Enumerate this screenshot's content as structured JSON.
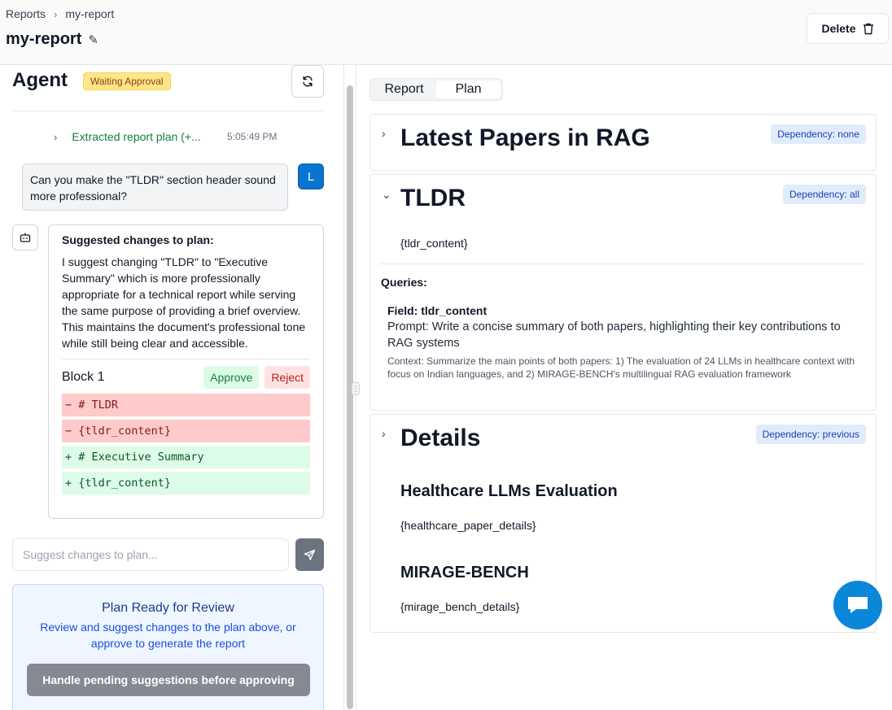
{
  "breadcrumb": {
    "root": "Reports",
    "separator": "›",
    "current": "my-report"
  },
  "header": {
    "title": "my-report",
    "delete_label": "Delete"
  },
  "agent": {
    "title": "Agent",
    "status_badge": "Waiting Approval",
    "extracted_text": "Extracted report plan (+...",
    "extracted_time": "5:05:49 PM",
    "user_message": "Can you make the \"TLDR\" section header sound more professional?",
    "user_avatar": "L",
    "suggestion": {
      "title": "Suggested changes to plan:",
      "body": "I suggest changing \"TLDR\" to \"Executive Summary\" which is more professionally appropriate for a technical report while serving the same purpose of providing a brief overview. This maintains the document's professional tone while still being clear and accessible.",
      "block_label": "Block 1",
      "approve_label": "Approve",
      "reject_label": "Reject",
      "diff": [
        {
          "type": "del",
          "text": "− # TLDR"
        },
        {
          "type": "del",
          "text": "− {tldr_content}"
        },
        {
          "type": "add",
          "text": "+ # Executive Summary"
        },
        {
          "type": "add",
          "text": "+ {tldr_content}"
        }
      ]
    },
    "input_placeholder": "Suggest changes to plan...",
    "review": {
      "title": "Plan Ready for Review",
      "text": "Review and suggest changes to the plan above, or approve to generate the report",
      "button_label": "Handle pending suggestions before approving"
    }
  },
  "tabs": [
    {
      "label": "Report",
      "active": false
    },
    {
      "label": "Plan",
      "active": true
    }
  ],
  "plan": {
    "sections": [
      {
        "title": "Latest Papers in RAG",
        "dependency": "Dependency: none",
        "expanded": false
      },
      {
        "title": "TLDR",
        "dependency": "Dependency: all",
        "expanded": true,
        "content": "{tldr_content}",
        "queries_label": "Queries:",
        "query_field": "Field: tldr_content",
        "query_prompt": "Prompt: Write a concise summary of both papers, highlighting their key contributions to RAG systems",
        "query_context": "Context: Summarize the main points of both papers: 1) The evaluation of 24 LLMs in healthcare context with focus on Indian languages, and 2) MIRAGE-BENCH's multilingual RAG evaluation framework"
      },
      {
        "title": "Details",
        "dependency": "Dependency: previous",
        "expanded": false,
        "subsections": [
          {
            "title": "Healthcare LLMs Evaluation",
            "content": "{healthcare_paper_details}"
          },
          {
            "title": "MIRAGE-BENCH",
            "content": "{mirage_bench_details}"
          }
        ]
      }
    ]
  },
  "colors": {
    "accent_green": "#15803d",
    "avatar_blue": "#0a75d1",
    "badge_yellow": "#fde68a",
    "fab_blue": "#0a87d8"
  }
}
